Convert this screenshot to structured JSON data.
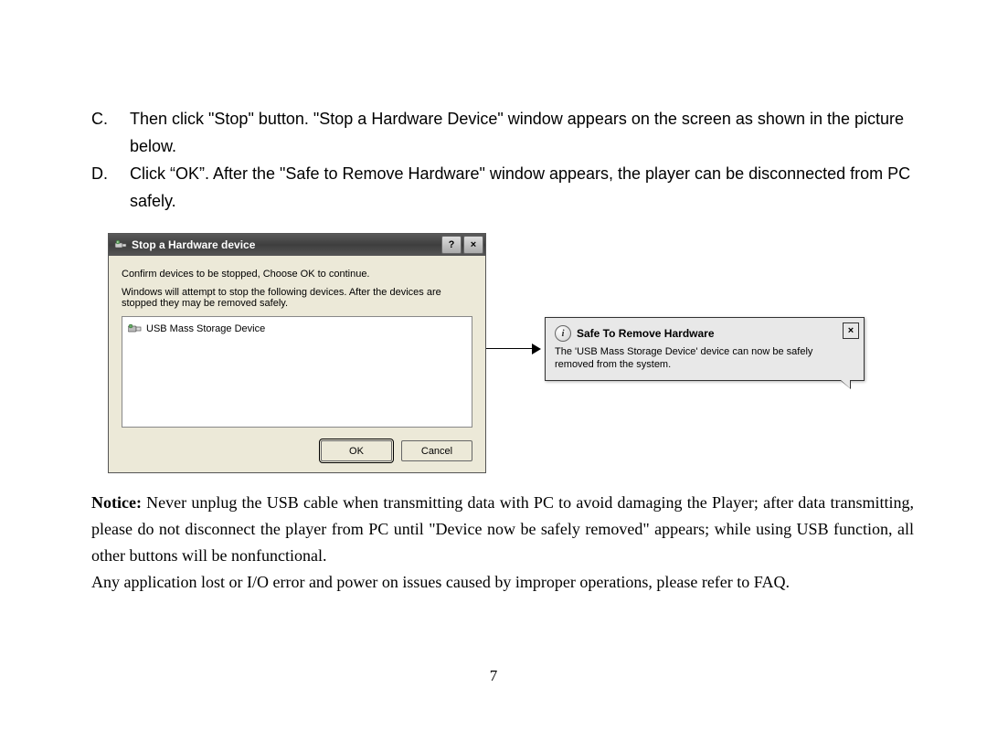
{
  "instructions": {
    "c": {
      "letter": "C.",
      "text": "Then click \"Stop\" button. \"Stop a Hardware Device\" window appears on the screen as shown in the picture below."
    },
    "d": {
      "letter": "D.",
      "text": "Click “OK”. After the \"Safe to Remove Hardware\" window appears, the player can be disconnected from PC safely."
    }
  },
  "dialog": {
    "title": "Stop a Hardware device",
    "help_glyph": "?",
    "close_glyph": "×",
    "line1": "Confirm devices to be stopped, Choose OK to continue.",
    "line2": "Windows will attempt to stop the following devices. After the devices are stopped they may be removed safely.",
    "device": "USB Mass Storage Device",
    "ok": "OK",
    "cancel": "Cancel"
  },
  "balloon": {
    "title": "Safe To Remove Hardware",
    "close_glyph": "×",
    "info_glyph": "i",
    "message": "The 'USB Mass Storage Device' device can now be safely removed from the system."
  },
  "notice": {
    "lead": "Notice:",
    "text1": " Never unplug the USB cable when transmitting data with PC to avoid damaging the Player; after data transmitting, please do not disconnect the player from PC until \"Device now be safely removed\" appears; while using USB function, all other buttons will be nonfunctional.",
    "text2": "Any application lost or I/O error and power on issues caused by improper operations, please refer to FAQ."
  },
  "page_number": "7"
}
